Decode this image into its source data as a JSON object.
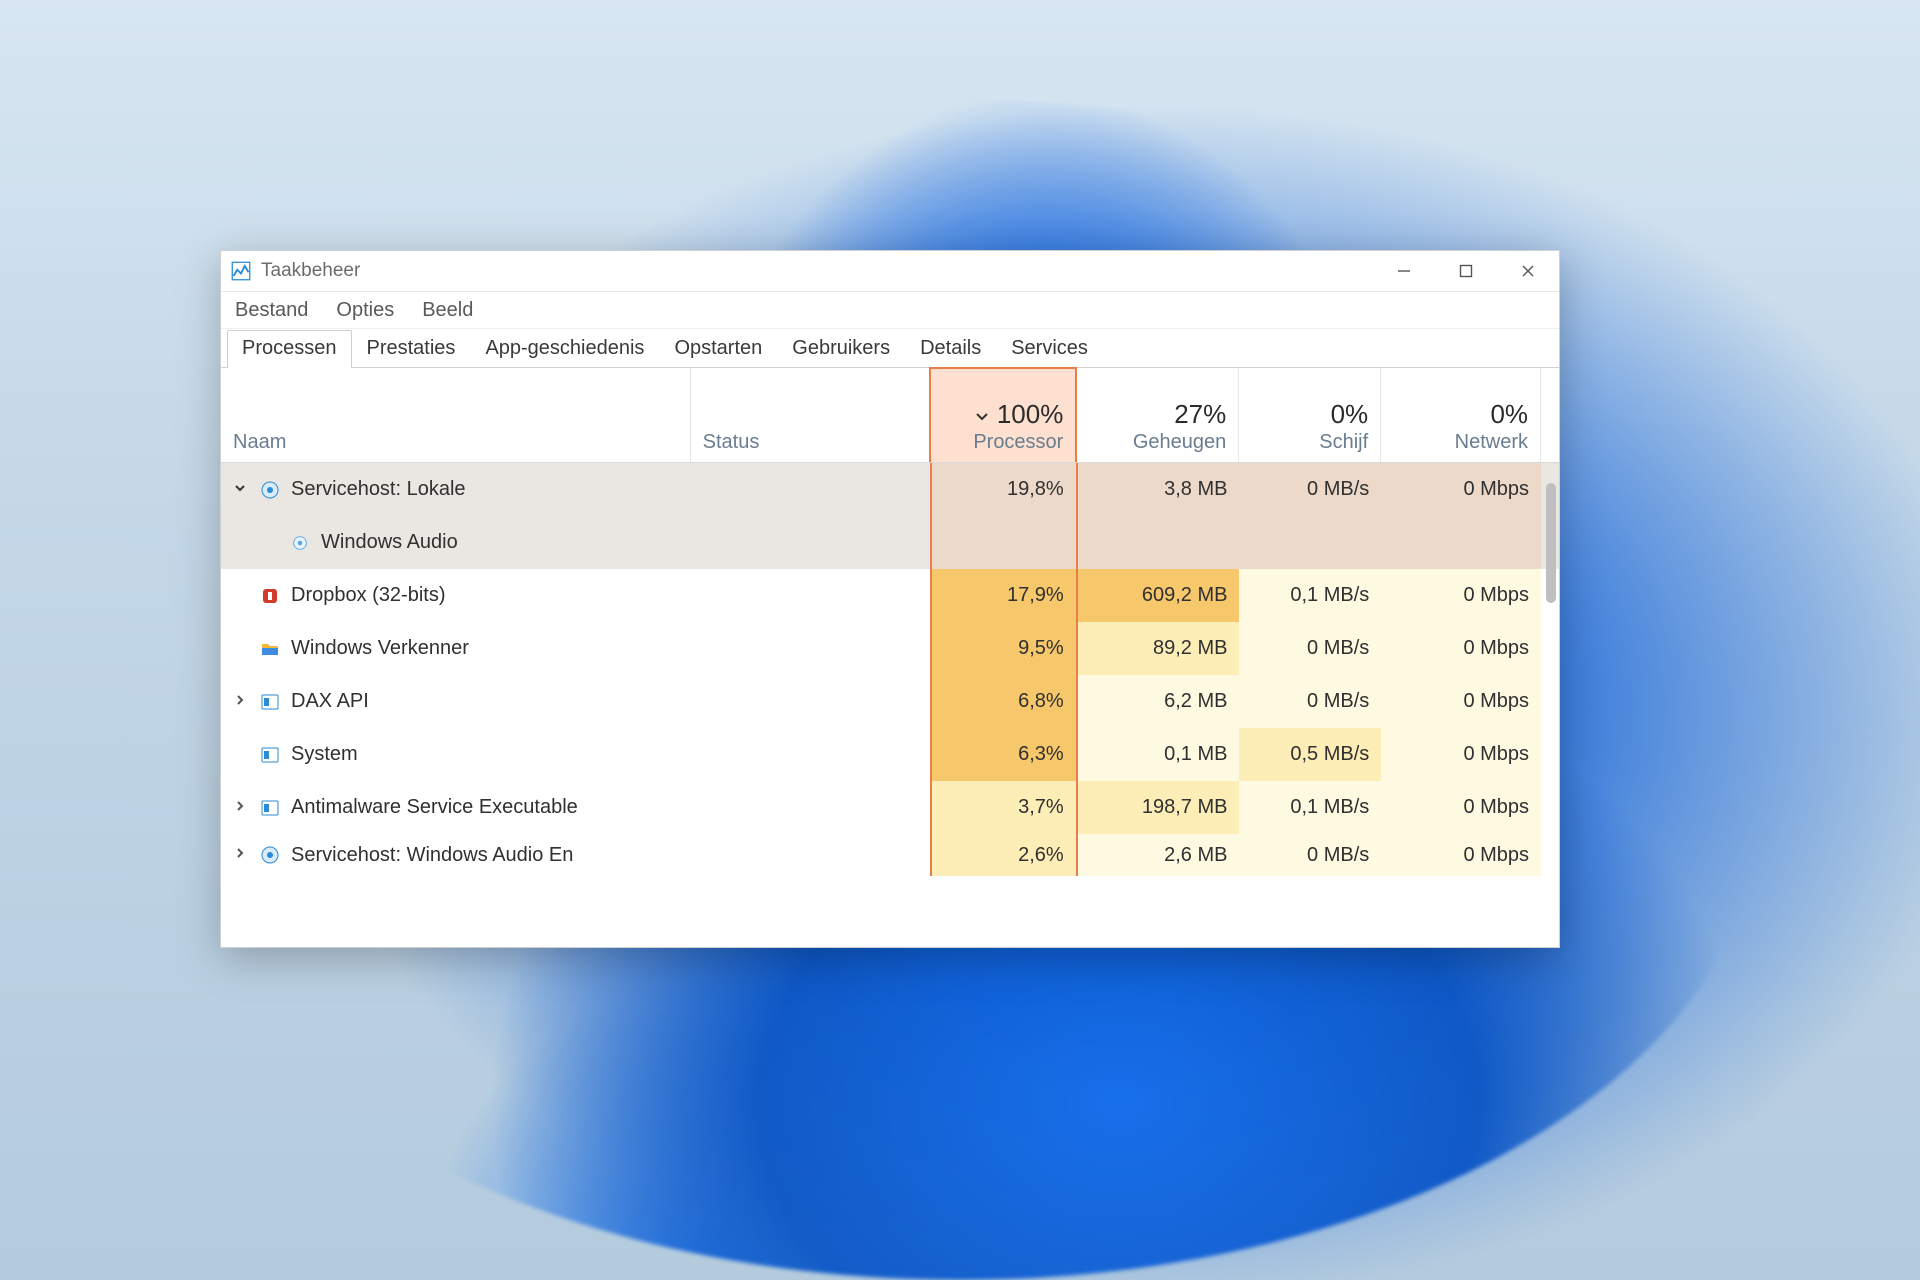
{
  "window": {
    "title": "Taakbeheer",
    "controls": {
      "minimize": "minimize",
      "maximize": "maximize",
      "close": "close"
    }
  },
  "menu": {
    "file": "Bestand",
    "options": "Opties",
    "view": "Beeld"
  },
  "tabs": {
    "processes": "Processen",
    "performance": "Prestaties",
    "history": "App-geschiedenis",
    "startup": "Opstarten",
    "users": "Gebruikers",
    "details": "Details",
    "services": "Services"
  },
  "columns": {
    "name": "Naam",
    "status": "Status",
    "processor": {
      "pct": "100%",
      "label": "Processor"
    },
    "memory": {
      "pct": "27%",
      "label": "Geheugen"
    },
    "disk": {
      "pct": "0%",
      "label": "Schijf"
    },
    "network": {
      "pct": "0%",
      "label": "Netwerk"
    }
  },
  "rows": [
    {
      "name": "Servicehost: Lokale",
      "icon": "gear",
      "expander": "down",
      "selected": true,
      "proc": "19,8%",
      "mem": "3,8 MB",
      "disk": "0 MB/s",
      "net": "0 Mbps",
      "heat": [
        "sel",
        "sel",
        "sel",
        "sel"
      ]
    },
    {
      "name": "Windows Audio",
      "icon": "gearsm",
      "expander": "",
      "selected": true,
      "child": true,
      "proc": "",
      "mem": "",
      "disk": "",
      "net": "",
      "heat": [
        "sel",
        "sel",
        "sel",
        "sel"
      ]
    },
    {
      "name": "Dropbox (32-bits)",
      "icon": "dropbox",
      "expander": "",
      "proc": "17,9%",
      "mem": "609,2 MB",
      "disk": "0,1 MB/s",
      "net": "0 Mbps",
      "heat": [
        "high",
        "high",
        "low",
        "low"
      ]
    },
    {
      "name": "Windows Verkenner",
      "icon": "folder",
      "expander": "",
      "proc": "9,5%",
      "mem": "89,2 MB",
      "disk": "0 MB/s",
      "net": "0 Mbps",
      "heat": [
        "high",
        "mid",
        "low",
        "low"
      ]
    },
    {
      "name": "DAX API",
      "icon": "app",
      "expander": "right",
      "proc": "6,8%",
      "mem": "6,2 MB",
      "disk": "0 MB/s",
      "net": "0 Mbps",
      "heat": [
        "high",
        "low",
        "low",
        "low"
      ]
    },
    {
      "name": "System",
      "icon": "app",
      "expander": "",
      "proc": "6,3%",
      "mem": "0,1 MB",
      "disk": "0,5 MB/s",
      "net": "0 Mbps",
      "heat": [
        "high",
        "low",
        "mid",
        "low"
      ]
    },
    {
      "name": "Antimalware Service Executable",
      "icon": "app",
      "expander": "right",
      "proc": "3,7%",
      "mem": "198,7 MB",
      "disk": "0,1 MB/s",
      "net": "0 Mbps",
      "heat": [
        "mid",
        "mid",
        "low",
        "low"
      ]
    },
    {
      "name": "Servicehost: Windows Audio En",
      "icon": "gear",
      "expander": "right",
      "last": true,
      "proc": "2,6%",
      "mem": "2,6 MB",
      "disk": "0 MB/s",
      "net": "0 Mbps",
      "heat": [
        "mid",
        "low",
        "low",
        "low"
      ]
    }
  ]
}
